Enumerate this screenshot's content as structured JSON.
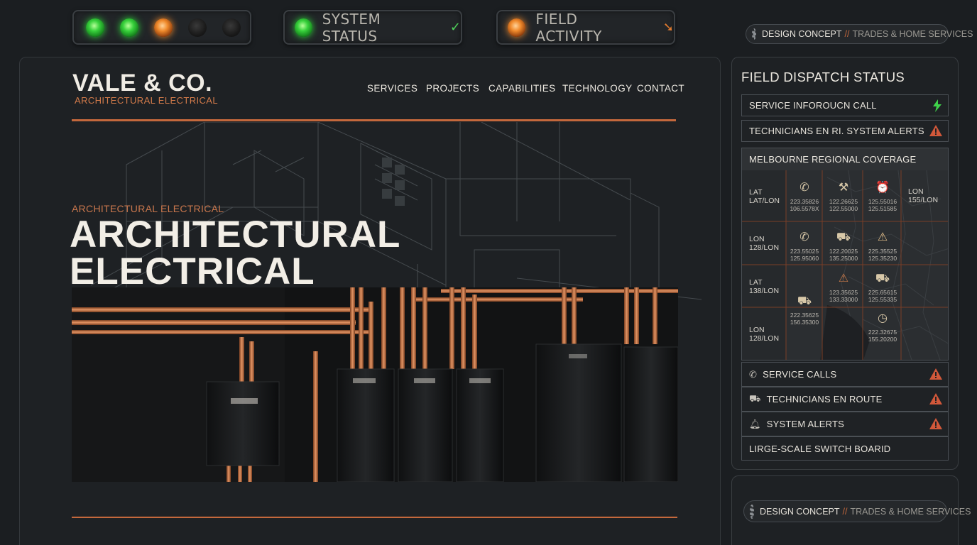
{
  "status_bar": {
    "leds": [
      "green",
      "green",
      "orange",
      "off",
      "off"
    ],
    "system_status": {
      "label": "SYSTEM STATUS",
      "led": "green",
      "icon": "check-icon"
    },
    "field_activity": {
      "label": "FIELD ACTIVITY",
      "led": "orange",
      "icon": "arrow-down-right-icon"
    }
  },
  "concept_chip_top": {
    "label": "DESIGN CONCEPT",
    "sep": "//",
    "sub": "TRADES & HOME SERVICES"
  },
  "site": {
    "logo": "VALE & CO.",
    "logo_sub": "ARCHITECTURAL ELECTRICAL",
    "nav": [
      "SERVICES",
      "PROJECTS",
      "CAPABILITIES",
      "TECHNOLOGY",
      "CONTACT"
    ],
    "hero_eyebrow": "ARCHITECTURAL ELECTRICAL",
    "hero_title_line1": "ARCHITECTURAL",
    "hero_title_line2": "ELECTRICAL"
  },
  "dispatch": {
    "title": "FIELD DISPATCH STATUS",
    "top_rows": [
      {
        "label": "SERVICE INFOROUCN CALL",
        "icon": "bolt-icon"
      },
      {
        "label": "TECHNICIANS EN RI. SYSTEM ALERTS",
        "icon": "warning-icon"
      }
    ],
    "coverage": {
      "title": "MELBOURNE REGIONAL COVERAGE",
      "row_labels": [
        [
          "LAT",
          "LAT/LON"
        ],
        [
          "LON",
          "128/LON"
        ],
        [
          "LAT",
          "138/LON"
        ],
        [
          "LON",
          "128/LON"
        ]
      ],
      "right_label": [
        "LON",
        "155/LON"
      ],
      "cells": [
        {
          "icon": "phone-icon",
          "l1": "223.35826",
          "l2": "106.5578X"
        },
        {
          "icon": "tools-icon",
          "l1": "122.26625",
          "l2": "122.55000"
        },
        {
          "icon": "alarm-icon",
          "l1": "125.55016",
          "l2": "125.51585"
        },
        {
          "icon": "phone-icon",
          "l1": "223.55025",
          "l2": "125.95060"
        },
        {
          "icon": "truck-icon",
          "l1": "122.20025",
          "l2": "135.25000"
        },
        {
          "icon": "warning-icon",
          "l1": "225.35525",
          "l2": "125.35230"
        },
        {
          "icon": "alert-icon",
          "l1": "123.35625",
          "l2": "133.33000"
        },
        {
          "icon": "truck-icon",
          "l1": "225.65615",
          "l2": "125.55335"
        },
        {
          "icon": "truck-icon",
          "l1": "222.35625",
          "l2": "156.35300"
        },
        {
          "icon": "clock-icon",
          "l1": "222.32675",
          "l2": "155.20200"
        }
      ]
    },
    "bottom_rows": [
      {
        "label": "SERVICE CALLS",
        "left_icon": "phone-icon",
        "icon": "warning-icon"
      },
      {
        "label": "TECHNICIANS EN ROUTE",
        "left_icon": "truck-icon",
        "icon": "warning-icon"
      },
      {
        "label": "SYSTEM ALERTS",
        "left_icon": "bell-icon",
        "icon": "warning-icon"
      },
      {
        "label": "LIRGE-SCALE SWITCH BOARID"
      }
    ]
  },
  "concept_chip_bottom": {
    "label": "DESIGN CONCEPT",
    "sep": "//",
    "sub": "TRADES & HOME SERVICES"
  },
  "colors": {
    "accent": "#c4683c",
    "bg": "#1b1e21",
    "led_green": "#37d13b",
    "led_orange": "#f08a2b",
    "bolt": "#3fd24a",
    "warning": "#d2583a"
  }
}
